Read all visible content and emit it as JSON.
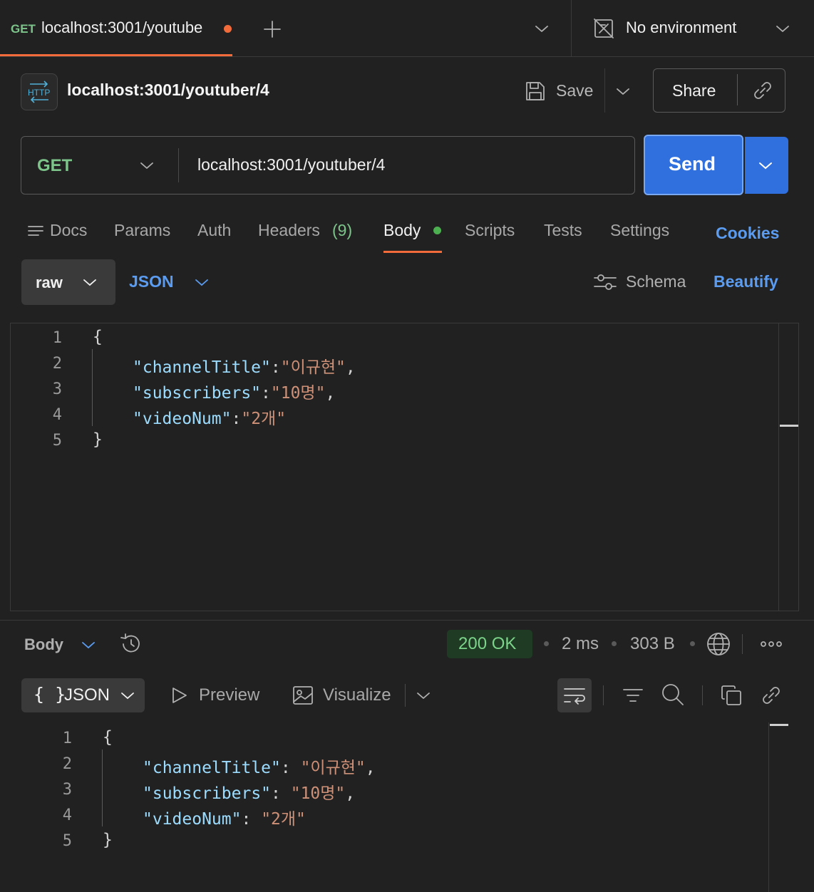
{
  "tab": {
    "method": "GET",
    "title": "localhost:3001/youtube"
  },
  "environment": {
    "label": "No environment"
  },
  "request": {
    "badge": "HTTP",
    "name": "localhost:3001/youtuber/4",
    "save_label": "Save",
    "share_label": "Share",
    "method": "GET",
    "url": "localhost:3001/youtuber/4",
    "send_label": "Send"
  },
  "request_tabs": {
    "docs": "Docs",
    "params": "Params",
    "auth": "Auth",
    "headers": "Headers",
    "headers_count": "(9)",
    "body": "Body",
    "scripts": "Scripts",
    "tests": "Tests",
    "settings": "Settings",
    "cookies": "Cookies"
  },
  "body_toolbar": {
    "mode": "raw",
    "format": "JSON",
    "schema": "Schema",
    "beautify": "Beautify"
  },
  "request_body": {
    "line_numbers": [
      "1",
      "2",
      "3",
      "4",
      "5"
    ],
    "open_brace": "{",
    "close_brace": "}",
    "lines": [
      {
        "key": "\"channelTitle\"",
        "value": "\"이규현\"",
        "trail": ","
      },
      {
        "key": "\"subscribers\"",
        "value": "\"10명\"",
        "trail": ","
      },
      {
        "key": "\"videoNum\"",
        "value": "\"2개\"",
        "trail": ""
      }
    ]
  },
  "response": {
    "section_label": "Body",
    "status": "200 OK",
    "time": "2 ms",
    "size": "303 B",
    "format": "JSON",
    "format_icon": "{ }",
    "preview": "Preview",
    "visualize": "Visualize",
    "line_numbers": [
      "1",
      "2",
      "3",
      "4",
      "5"
    ],
    "open_brace": "{",
    "close_brace": "}",
    "lines": [
      {
        "key": "\"channelTitle\"",
        "value": "\"이규현\"",
        "trail": ","
      },
      {
        "key": "\"subscribers\"",
        "value": "\"10명\"",
        "trail": ","
      },
      {
        "key": "\"videoNum\"",
        "value": "\"2개\"",
        "trail": ""
      }
    ]
  },
  "colors": {
    "accent": "#f26b3a",
    "send": "#2f6fde",
    "link": "#5b9cf0",
    "method_get": "#7cc48a",
    "status_ok": "#7cd48a",
    "json_key": "#9cdcfe",
    "json_string": "#ce9178"
  },
  "icons": [
    "plus-icon",
    "chevron-down-icon",
    "no-environment-icon",
    "http-icon",
    "save-icon",
    "link-icon",
    "docs-icon",
    "schema-icon",
    "history-icon",
    "globe-icon",
    "more-icon",
    "play-icon",
    "image-icon",
    "wrap-icon",
    "filter-icon",
    "search-icon",
    "copy-icon"
  ]
}
